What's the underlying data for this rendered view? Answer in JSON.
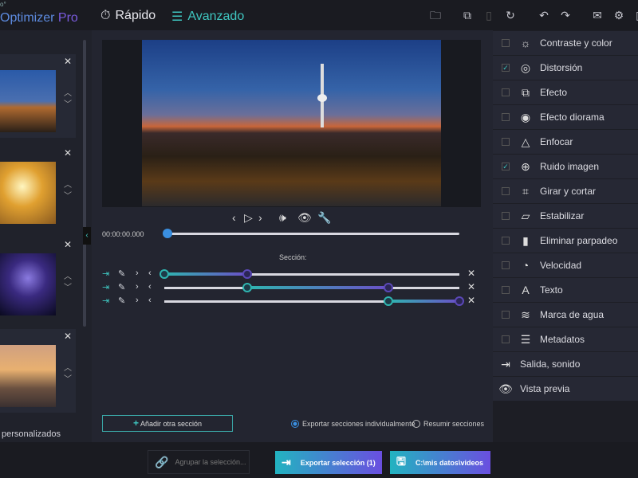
{
  "app": {
    "logo_small": "o°",
    "logo_main": "Optimizer",
    "logo_pro": "Pro"
  },
  "modes": {
    "fast": "Rápido",
    "advanced": "Avanzado"
  },
  "left": {
    "custom_label": "personalizados"
  },
  "player": {
    "time": "00:00:00.000",
    "position": 0
  },
  "sections": {
    "label": "Sección:",
    "rows": [
      {
        "start": 0,
        "end": 0.28
      },
      {
        "start": 0.28,
        "end": 0.76
      },
      {
        "start": 0.76,
        "end": 1.0
      }
    ],
    "add_label": "Añadir otra sección",
    "add_plus": "+",
    "opt_individual": "Exportar secciones individualmente",
    "opt_merge": "Resumir secciones"
  },
  "effects": [
    {
      "label": "Contraste y color",
      "checked": false,
      "icon": "☼"
    },
    {
      "label": "Distorsión",
      "checked": true,
      "icon": "◎"
    },
    {
      "label": "Efecto",
      "checked": false,
      "icon": "⧉"
    },
    {
      "label": "Efecto diorama",
      "checked": false,
      "icon": "◉"
    },
    {
      "label": "Enfocar",
      "checked": false,
      "icon": "△"
    },
    {
      "label": "Ruido imagen",
      "checked": true,
      "icon": "⊕"
    },
    {
      "label": "Girar y cortar",
      "checked": false,
      "icon": "⌗"
    },
    {
      "label": "Estabilizar",
      "checked": false,
      "icon": "▱"
    },
    {
      "label": "Eliminar parpadeo",
      "checked": false,
      "icon": "▮"
    },
    {
      "label": "Velocidad",
      "checked": false,
      "icon": "◔"
    },
    {
      "label": "Texto",
      "checked": false,
      "icon": "A"
    },
    {
      "label": "Marca de agua",
      "checked": false,
      "icon": "≋"
    },
    {
      "label": "Metadatos",
      "checked": false,
      "icon": "☰"
    }
  ],
  "extras": [
    {
      "label": "Salida, sonido",
      "icon": "⇥"
    },
    {
      "label": "Vista previa",
      "icon": "👁"
    }
  ],
  "bottom": {
    "group": "Agrupar la selección...",
    "export": "Exportar selección (1)",
    "path": "C:\\mis datos\\videos"
  }
}
